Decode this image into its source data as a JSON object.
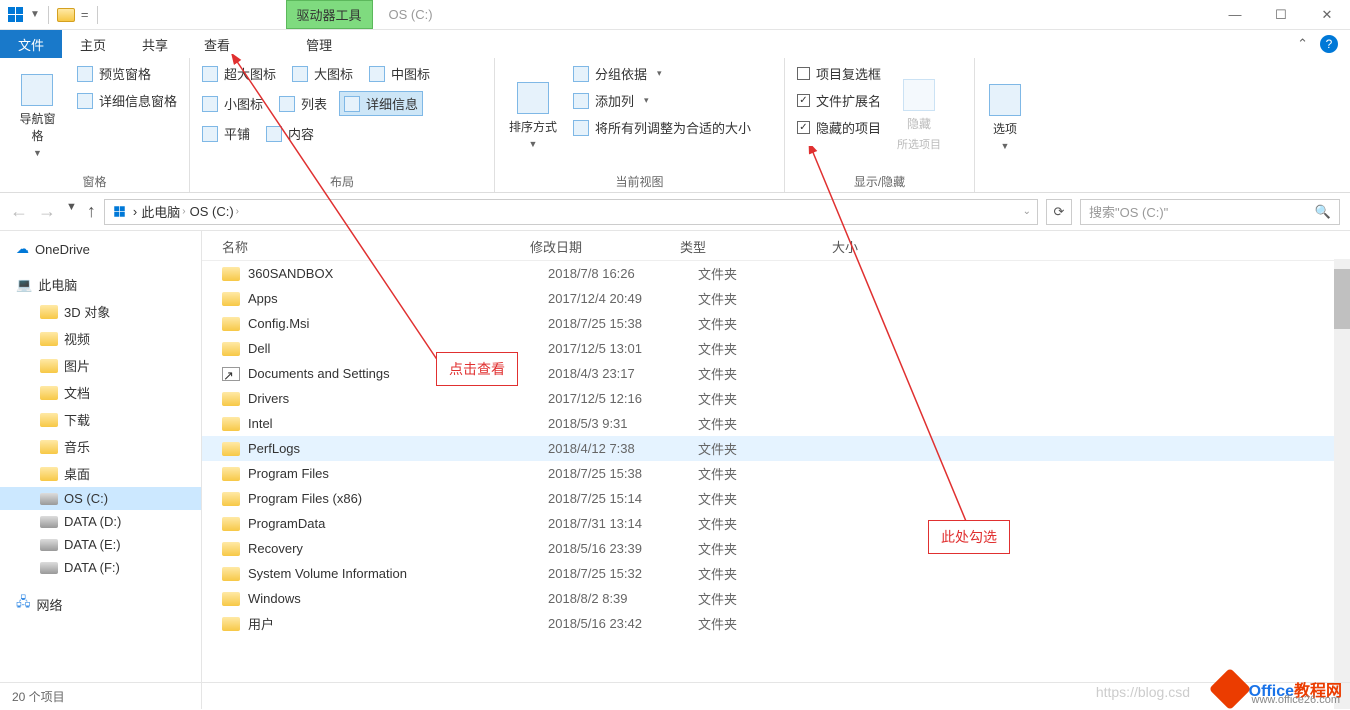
{
  "titlebar": {
    "contextual_tab": "驱动器工具",
    "window_title": "OS (C:)"
  },
  "tabs": {
    "file": "文件",
    "home": "主页",
    "share": "共享",
    "view": "查看",
    "manage": "管理"
  },
  "ribbon": {
    "panes": {
      "nav_pane": "导航窗格",
      "preview_pane": "预览窗格",
      "details_pane": "详细信息窗格",
      "group": "窗格"
    },
    "layout": {
      "extra_large": "超大图标",
      "large": "大图标",
      "medium": "中图标",
      "small": "小图标",
      "list": "列表",
      "details": "详细信息",
      "tiles": "平铺",
      "content": "内容",
      "group": "布局"
    },
    "current_view": {
      "sort": "排序方式",
      "group_by": "分组依据",
      "add_columns": "添加列",
      "size_all": "将所有列调整为合适的大小",
      "group": "当前视图"
    },
    "show_hide": {
      "item_check": "项目复选框",
      "file_ext": "文件扩展名",
      "hidden": "隐藏的项目",
      "hide_btn": "隐藏",
      "hide_sub": "所选项目",
      "group": "显示/隐藏"
    },
    "options": "选项"
  },
  "breadcrumb": {
    "this_pc": "此电脑",
    "drive": "OS (C:)"
  },
  "search": {
    "placeholder": "搜索\"OS (C:)\""
  },
  "tree": {
    "onedrive": "OneDrive",
    "this_pc": "此电脑",
    "items": [
      "3D 对象",
      "视频",
      "图片",
      "文档",
      "下载",
      "音乐",
      "桌面",
      "OS (C:)",
      "DATA (D:)",
      "DATA (E:)",
      "DATA (F:)"
    ],
    "network": "网络"
  },
  "columns": {
    "name": "名称",
    "date": "修改日期",
    "type": "类型",
    "size": "大小"
  },
  "files": [
    {
      "name": "360SANDBOX",
      "date": "2018/7/8 16:26",
      "type": "文件夹"
    },
    {
      "name": "Apps",
      "date": "2017/12/4 20:49",
      "type": "文件夹"
    },
    {
      "name": "Config.Msi",
      "date": "2018/7/25 15:38",
      "type": "文件夹"
    },
    {
      "name": "Dell",
      "date": "2017/12/5 13:01",
      "type": "文件夹"
    },
    {
      "name": "Documents and Settings",
      "date": "2018/4/3 23:17",
      "type": "文件夹",
      "link": true
    },
    {
      "name": "Drivers",
      "date": "2017/12/5 12:16",
      "type": "文件夹"
    },
    {
      "name": "Intel",
      "date": "2018/5/3 9:31",
      "type": "文件夹"
    },
    {
      "name": "PerfLogs",
      "date": "2018/4/12 7:38",
      "type": "文件夹",
      "selected": true
    },
    {
      "name": "Program Files",
      "date": "2018/7/25 15:38",
      "type": "文件夹"
    },
    {
      "name": "Program Files (x86)",
      "date": "2018/7/25 15:14",
      "type": "文件夹"
    },
    {
      "name": "ProgramData",
      "date": "2018/7/31 13:14",
      "type": "文件夹"
    },
    {
      "name": "Recovery",
      "date": "2018/5/16 23:39",
      "type": "文件夹"
    },
    {
      "name": "System Volume Information",
      "date": "2018/7/25 15:32",
      "type": "文件夹"
    },
    {
      "name": "Windows",
      "date": "2018/8/2 8:39",
      "type": "文件夹"
    },
    {
      "name": "用户",
      "date": "2018/5/16 23:42",
      "type": "文件夹"
    }
  ],
  "status": "20 个项目",
  "annotations": {
    "left": "点击查看",
    "right": "此处勾选"
  },
  "watermark": "https://blog.csd",
  "logo": {
    "main": "Office",
    "suffix": "教程网",
    "url": "www.office26.com"
  }
}
